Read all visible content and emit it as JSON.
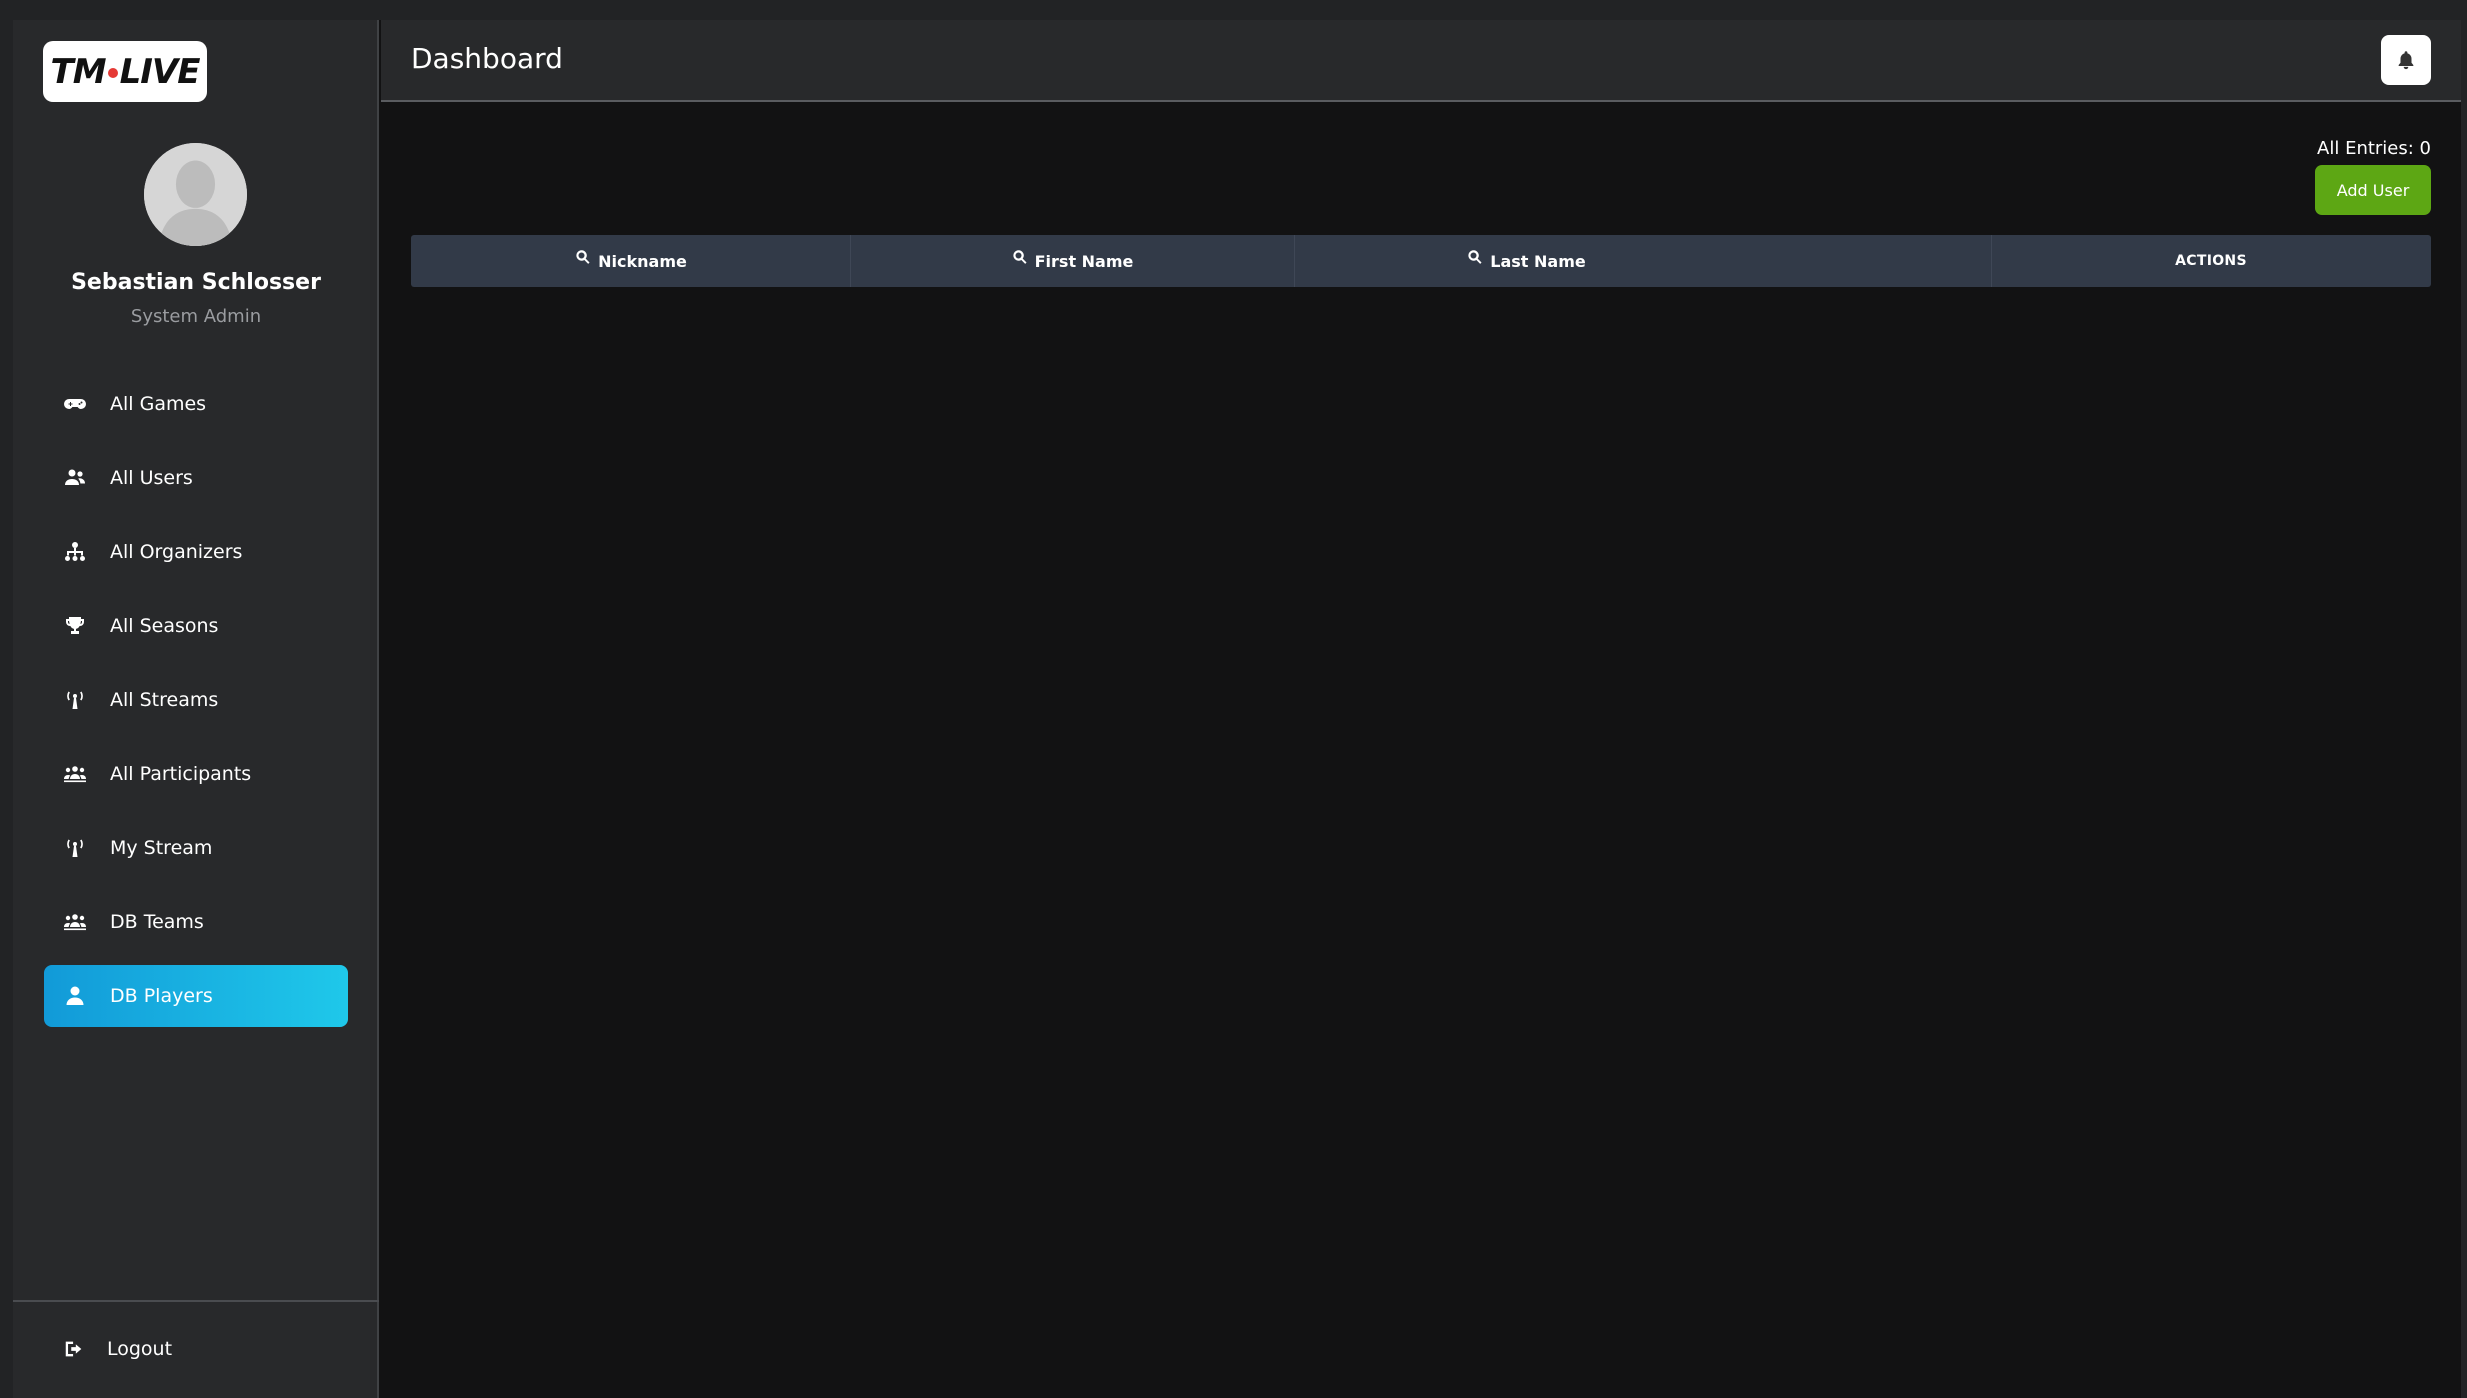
{
  "app": {
    "logo": {
      "part1": "TM",
      "part2": "LIVE"
    },
    "user": {
      "name": "Sebastian Schlosser",
      "role": "System Admin"
    }
  },
  "sidebar": {
    "items": [
      {
        "label": "All Games",
        "icon": "gamepad-icon",
        "active": false
      },
      {
        "label": "All Users",
        "icon": "users-icon",
        "active": false
      },
      {
        "label": "All Organizers",
        "icon": "sitemap-icon",
        "active": false
      },
      {
        "label": "All Seasons",
        "icon": "trophy-icon",
        "active": false
      },
      {
        "label": "All Streams",
        "icon": "broadcast-tower-icon",
        "active": false
      },
      {
        "label": "All Participants",
        "icon": "group-icon",
        "active": false
      },
      {
        "label": "My Stream",
        "icon": "broadcast-tower-icon",
        "active": false
      },
      {
        "label": "DB Teams",
        "icon": "group-icon",
        "active": false
      },
      {
        "label": "DB Players",
        "icon": "user-icon",
        "active": true
      }
    ],
    "logout_label": "Logout"
  },
  "header": {
    "title": "Dashboard",
    "notification_icon": "bell-icon"
  },
  "main": {
    "entries_label": "All Entries: 0",
    "add_user_label": "Add User",
    "table": {
      "columns": [
        "Nickname",
        "First Name",
        "Last Name",
        "ACTIONS"
      ],
      "rows": []
    }
  },
  "colors": {
    "active_gradient_start": "#129ad8",
    "active_gradient_end": "#1fc8ea",
    "add_button": "#5da714",
    "table_header": "#323a48",
    "logo_dot": "#e53935"
  }
}
